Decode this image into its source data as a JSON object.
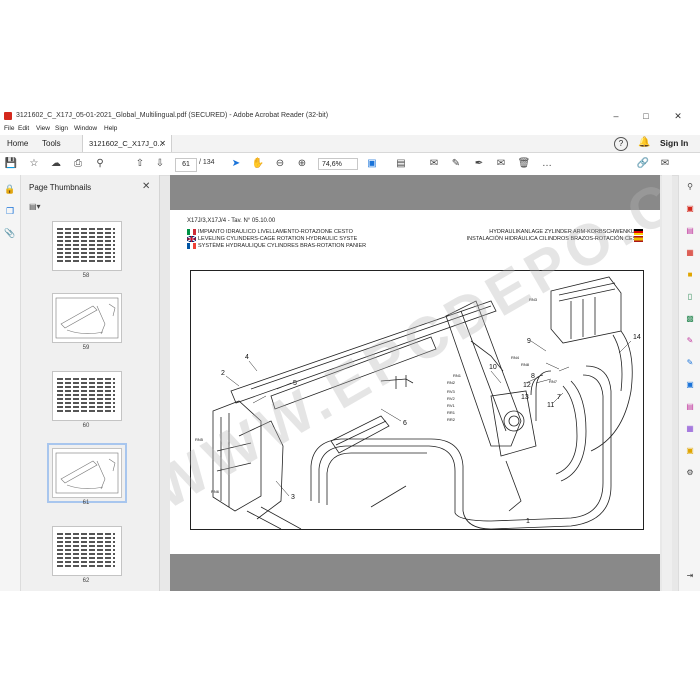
{
  "window": {
    "title": "3121602_C_X17J_05-01-2021_Global_Multilingual.pdf (SECURED) - Adobe Acrobat Reader (32-bit)"
  },
  "menu": [
    "File",
    "Edit",
    "View",
    "Sign",
    "Window",
    "Help"
  ],
  "tabs": {
    "home": "Home",
    "tools": "Tools",
    "document": "3121602_C_X17J_0..."
  },
  "signin": "Sign In",
  "toolbar": {
    "page_current": "61",
    "page_total": "/ 134",
    "zoom": "74,6%"
  },
  "panel": {
    "title": "Page Thumbnails",
    "thumbnails": [
      {
        "num": "58",
        "kind": "table"
      },
      {
        "num": "59",
        "kind": "drawing"
      },
      {
        "num": "60",
        "kind": "table"
      },
      {
        "num": "61",
        "kind": "drawing",
        "selected": true
      },
      {
        "num": "62",
        "kind": "table"
      }
    ]
  },
  "page": {
    "model": "X17J/3,X17J/4 - Tav. N° 05.10.00",
    "left_titles": [
      "IMPIANTO IDRAULICO LIVELLAMENTO-ROTAZIONE CESTO",
      "LEVELING CYLINDERS-CAGE ROTATION HYDRAULIC SYSTE",
      "SYSTÈME HYDRAULIQUE CYLINDRES BRAS-ROTATION PANIER"
    ],
    "right_titles": [
      "HYDRAULIKANLAGE ZYLINDER  ARM-KORBSCHWENKUNG",
      "INSTALACIÓN HIDRÁULICA CILINDROS BRAZOS-ROTACIÓN CESTA"
    ],
    "callouts": [
      "1",
      "2",
      "3",
      "4",
      "5",
      "6",
      "7",
      "8",
      "9",
      "10",
      "11",
      "12",
      "13",
      "14"
    ],
    "small_labels": [
      "RN3",
      "RN4",
      "RN5",
      "RN6",
      "RN7",
      "RN8",
      "RN1",
      "RN2",
      "RV3",
      "RV2",
      "RV1",
      "RR1",
      "RR2"
    ]
  },
  "watermark": "WWW.EPCDEPO.COM",
  "colors": {
    "acrobat_red": "#d4281c",
    "doc_bg": "#898989",
    "accent_blue": "#1a73d9"
  }
}
